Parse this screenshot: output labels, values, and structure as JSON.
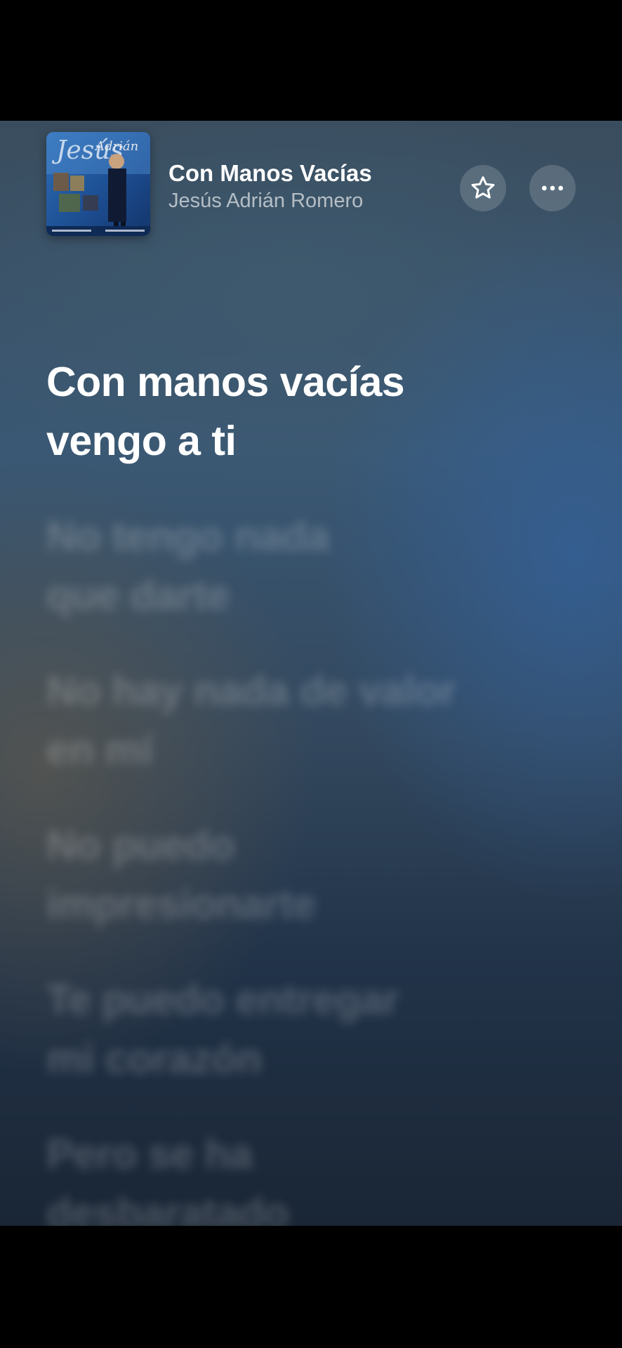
{
  "now_playing": {
    "title": "Con Manos Vacías",
    "artist": "Jesús Adrián Romero",
    "album_art_label": "Jesús Adrián Romero",
    "album_art_icon": "album-cover"
  },
  "actions": {
    "favorite_icon": "star-icon",
    "more_icon": "ellipsis-icon"
  },
  "lyrics": [
    {
      "text": "Con manos vacías\nvengo a ti",
      "active": true
    },
    {
      "text": "No tengo nada\nque darte",
      "active": false
    },
    {
      "text": "No hay nada de valor\nen mí",
      "active": false
    },
    {
      "text": "No puedo\nimpresionarte",
      "active": false
    },
    {
      "text": "Te puedo entregar\nmi corazón",
      "active": false
    },
    {
      "text": "Pero se ha\ndesbaratado",
      "active": false
    }
  ],
  "colors": {
    "accent": "#ffffff",
    "background_top": "#3a4d5e",
    "background_bottom": "#1a2635"
  }
}
